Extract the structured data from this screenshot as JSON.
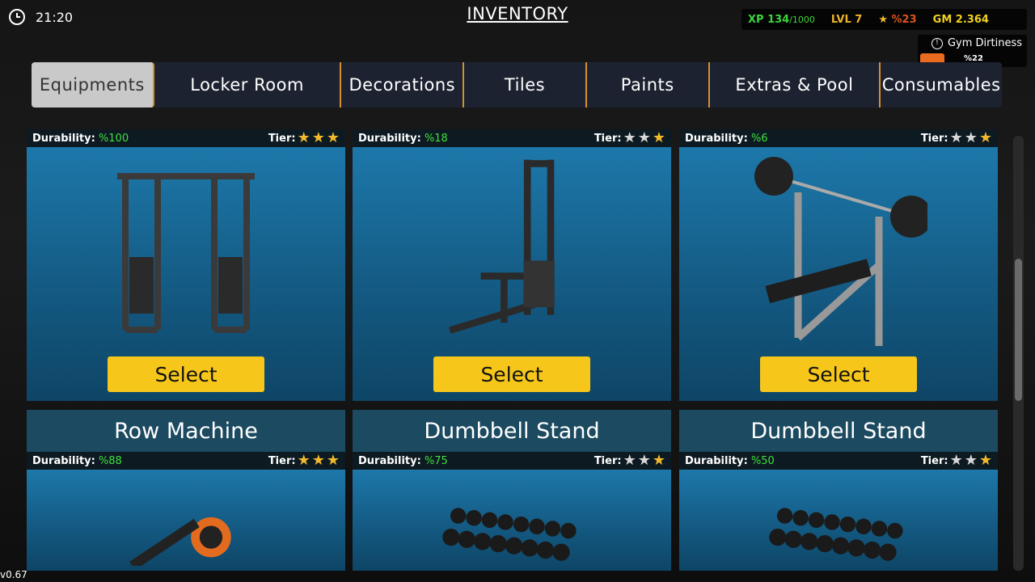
{
  "header": {
    "time": "21:20",
    "title": "INVENTORY"
  },
  "stats": {
    "xp": "XP 134",
    "xp_max": "/1000",
    "level": "LVL 7",
    "rating": "%23",
    "gm": "GM 2.364"
  },
  "dirtiness": {
    "label": "Gym Dirtiness",
    "value": "%22",
    "level": 22,
    "color": "#ea6a20"
  },
  "tabs": [
    "Equipments",
    "Locker Room",
    "Decorations",
    "Tiles",
    "Paints",
    "Extras & Pool",
    "Consumables"
  ],
  "active_tab": "Equipments",
  "cards": [
    {
      "durability_label": "Durability:",
      "durability": "%100",
      "tier_label": "Tier:",
      "stars": [
        1,
        1,
        1
      ],
      "select": "Select",
      "icon": "functional-trainer"
    },
    {
      "durability_label": "Durability:",
      "durability": "%18",
      "tier_label": "Tier:",
      "stars": [
        0,
        0,
        1
      ],
      "select": "Select",
      "icon": "lat-pulldown"
    },
    {
      "durability_label": "Durability:",
      "durability": "%6",
      "tier_label": "Tier:",
      "stars": [
        0,
        0,
        1
      ],
      "select": "Select",
      "icon": "bench-press"
    },
    {
      "name": "Row Machine",
      "durability_label": "Durability:",
      "durability": "%88",
      "tier_label": "Tier:",
      "stars": [
        1,
        1,
        1
      ],
      "icon": "row-machine"
    },
    {
      "name": "Dumbbell Stand",
      "durability_label": "Durability:",
      "durability": "%75",
      "tier_label": "Tier:",
      "stars": [
        0,
        0,
        1
      ],
      "icon": "dumbbell-rack"
    },
    {
      "name": "Dumbbell Stand",
      "durability_label": "Durability:",
      "durability": "%50",
      "tier_label": "Tier:",
      "stars": [
        0,
        0,
        1
      ],
      "icon": "dumbbell-rack"
    }
  ],
  "colors": {
    "star_gold": "#f2b92e",
    "star_silver": "#d8d8d8",
    "select": "#f6c71a",
    "durability": "#3fe03f"
  },
  "version": "v0.67"
}
